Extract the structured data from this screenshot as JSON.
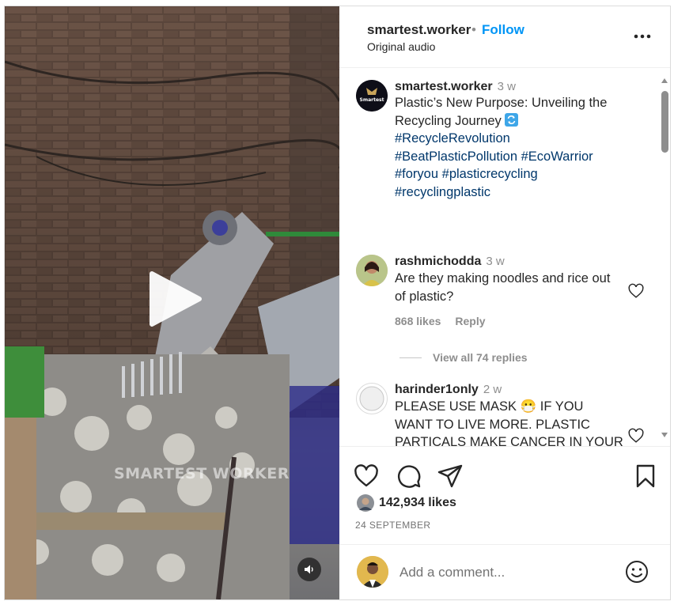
{
  "header": {
    "username": "smartest.worker",
    "separator": "•",
    "follow_label": "Follow",
    "audio_label": "Original audio",
    "more_icon": "more-options-icon"
  },
  "media": {
    "watermark": "SMARTEST WORKER",
    "avatar_text": "Smartest",
    "play_icon": "play-icon",
    "mute_icon": "speaker-icon"
  },
  "caption": {
    "username": "smartest.worker",
    "time": "3 w",
    "text_line1": "Plastic’s New Purpose: Unveiling the",
    "text_line2": "Recycling Journey",
    "emoji": "🔄",
    "hashtags_line1": "#RecycleRevolution",
    "hashtags_line2a": "#BeatPlasticPollution",
    "hashtags_line2b": "#EcoWarrior",
    "hashtags_line3a": "#foryou",
    "hashtags_line3b": "#plasticrecycling",
    "hashtags_line4": "#recyclingplastic"
  },
  "comments": [
    {
      "username": "rashmichodda",
      "time": "3 w",
      "text": "Are they making noodles and rice out of plastic?",
      "likes": "868 likes",
      "reply": "Reply",
      "view_replies": "View all 74 replies"
    },
    {
      "username": "harinder1only",
      "time": "2 w",
      "text": "PLEASE USE MASK 😷 IF YOU WANT TO LIVE MORE. PLASTIC PARTICALS MAKE CANCER IN YOUR"
    }
  ],
  "actions": {
    "likes": "142,934 likes",
    "date": "24 SEPTEMBER"
  },
  "add_comment": {
    "placeholder": "Add a comment..."
  },
  "colors": {
    "accent": "#0095f6",
    "hashtag": "#00376b",
    "secondary_text": "#8e8e8e"
  }
}
